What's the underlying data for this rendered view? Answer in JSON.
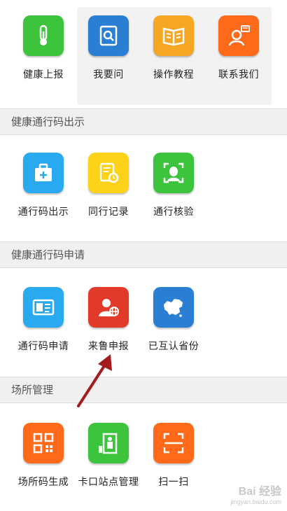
{
  "colors": {
    "green": "#3cc43c",
    "blue": "#2a7fd4",
    "orange": "#f5a623",
    "deep_orange": "#ff6a1a",
    "cyan": "#29aaf0",
    "yellow": "#ffd21a",
    "red": "#e23a28",
    "dark_red": "#a31b1b"
  },
  "top_row": [
    {
      "label": "健康上报",
      "icon": "thermometer-icon"
    },
    {
      "label": "我要问",
      "icon": "search-doc-icon"
    },
    {
      "label": "操作教程",
      "icon": "book-icon"
    },
    {
      "label": "联系我们",
      "icon": "support-agent-icon"
    }
  ],
  "sections": [
    {
      "title": "健康通行码出示",
      "items": [
        {
          "label": "通行码出示",
          "icon": "medical-kit-icon"
        },
        {
          "label": "同行记录",
          "icon": "document-clock-icon"
        },
        {
          "label": "通行核验",
          "icon": "face-scan-icon"
        }
      ]
    },
    {
      "title": "健康通行码申请",
      "items": [
        {
          "label": "通行码申请",
          "icon": "id-card-icon"
        },
        {
          "label": "来鲁申报",
          "icon": "person-globe-icon"
        },
        {
          "label": "已互认省份",
          "icon": "china-map-icon"
        }
      ]
    },
    {
      "title": "场所管理",
      "items": [
        {
          "label": "场所码生成",
          "icon": "qr-code-icon"
        },
        {
          "label": "卡口站点管理",
          "icon": "checkpoint-icon"
        },
        {
          "label": "扫一扫",
          "icon": "scan-icon"
        }
      ]
    }
  ],
  "watermark": {
    "main": "Bai 经验",
    "sub": "jingyan.baidu.com"
  }
}
